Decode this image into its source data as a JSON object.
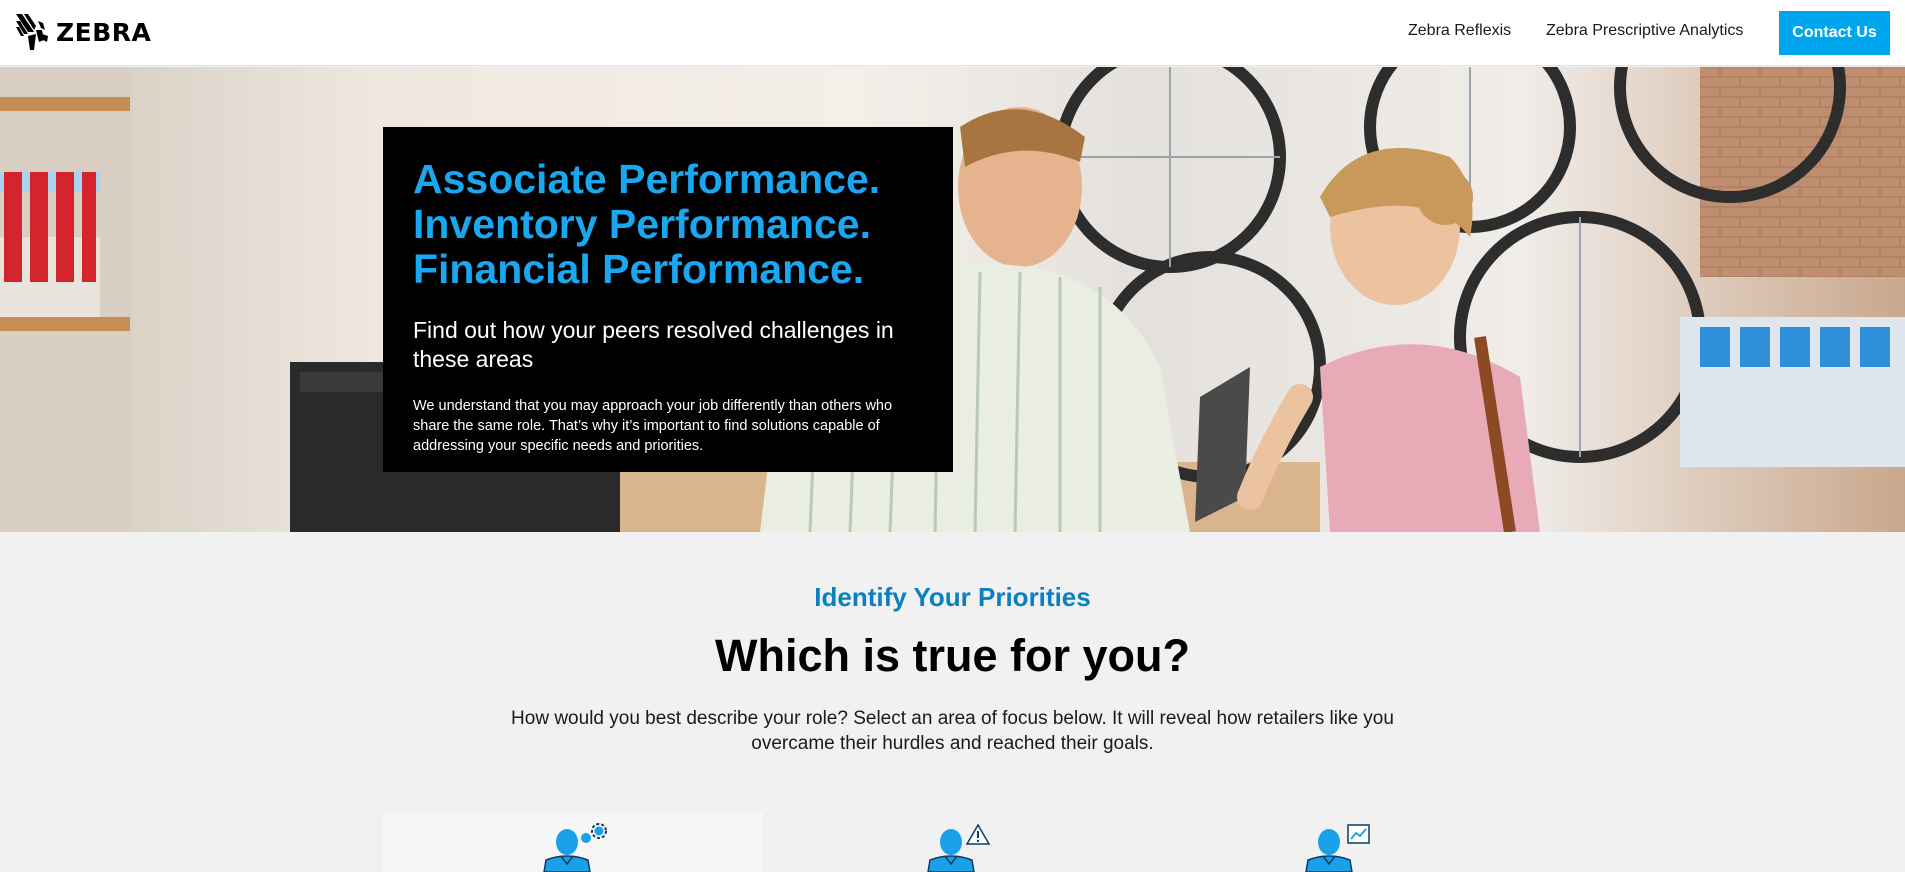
{
  "header": {
    "brand": "ZEBRA",
    "nav": [
      {
        "label": "Zebra Reflexis"
      },
      {
        "label": "Zebra Prescriptive Analytics"
      }
    ],
    "cta_label": "Contact Us"
  },
  "hero": {
    "title_lines": [
      "Associate Performance.",
      "Inventory Performance.",
      "Financial Performance."
    ],
    "subtitle": "Find out how your peers resolved challenges in these areas",
    "body": "We understand that you may approach your job differently than others who share the same role. That’s why it’s important to find solutions capable of addressing your specific needs and priorities."
  },
  "priorities": {
    "eyebrow": "Identify Your Priorities",
    "headline": "Which is true for you?",
    "description_lines": [
      "How would you best describe your role? Select an area of focus below. It will reveal how retailers like you",
      "overcame their hurdles and reached their goals."
    ],
    "roles": [
      {
        "icon": "person-gear-icon"
      },
      {
        "icon": "person-warning-icon"
      },
      {
        "icon": "person-chart-icon"
      }
    ]
  },
  "colors": {
    "accent": "#00a6ed",
    "hero_title": "#1aa7f0",
    "eyebrow": "#0a80c2",
    "hero_card": "#000000"
  }
}
